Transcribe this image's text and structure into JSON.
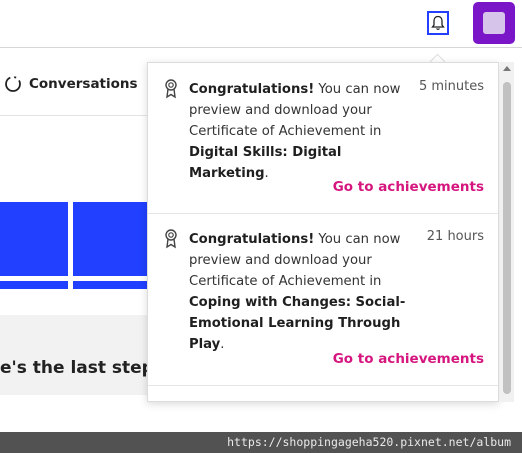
{
  "header": {
    "bell_icon": "bell-icon",
    "avatar_color": "#7b16c8"
  },
  "nav": {
    "conversations_label": "Conversations",
    "conversations_icon": "loading-circle-icon"
  },
  "page": {
    "partial_heading": "e's the last step",
    "tile_color": "#2140ff"
  },
  "notifications": [
    {
      "icon": "certificate-icon",
      "time": "5 minutes",
      "bold_start": "Congratulations!",
      "text_mid": " You can now preview and download your Certificate of Achievement in ",
      "course": "Digital Skills: Digital Marketing",
      "text_end": ".",
      "link_label": "Go to achievements"
    },
    {
      "icon": "certificate-icon",
      "time": "21 hours",
      "bold_start": "Congratulations!",
      "text_mid": " You can now preview and download your Certificate of Achievement in ",
      "course": "Coping with Changes: Social-Emotional Learning Through Play",
      "text_end": ".",
      "link_label": "Go to achievements"
    }
  ],
  "link_color": "#d6167f",
  "watermark": "https://shoppingageha520.pixnet.net/album"
}
